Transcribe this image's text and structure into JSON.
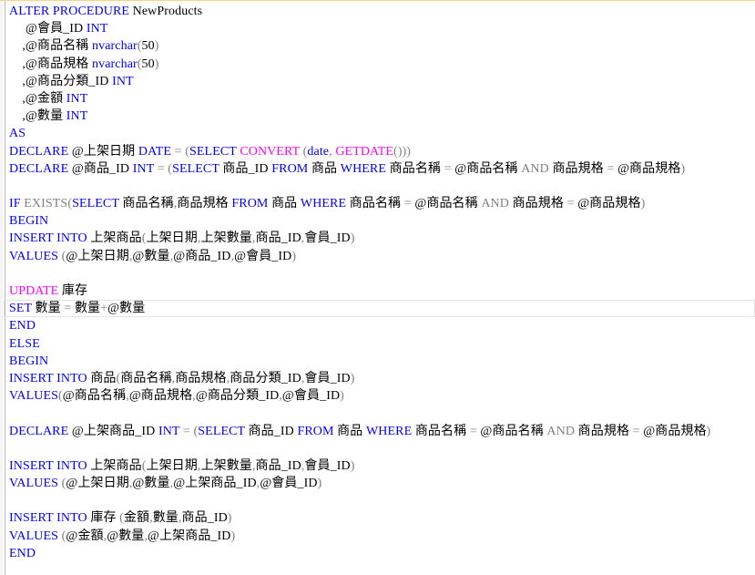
{
  "editor": {
    "lines": [
      [
        [
          "k",
          "ALTER PROCEDURE"
        ],
        [
          "t",
          " NewProducts"
        ]
      ],
      [
        [
          "t",
          "     @會員_ID "
        ],
        [
          "k",
          "INT"
        ]
      ],
      [
        [
          "t",
          "    ,@商品名稱 "
        ],
        [
          "k",
          "nvarchar"
        ],
        [
          "g",
          "("
        ],
        [
          "t",
          "50"
        ],
        [
          "g",
          ")"
        ]
      ],
      [
        [
          "t",
          "    ,@商品規格 "
        ],
        [
          "k",
          "nvarchar"
        ],
        [
          "g",
          "("
        ],
        [
          "t",
          "50"
        ],
        [
          "g",
          ")"
        ]
      ],
      [
        [
          "t",
          "    ,@商品分類_ID "
        ],
        [
          "k",
          "INT"
        ]
      ],
      [
        [
          "t",
          "    ,@金額 "
        ],
        [
          "k",
          "INT"
        ]
      ],
      [
        [
          "t",
          "    ,@數量 "
        ],
        [
          "k",
          "INT"
        ]
      ],
      [
        [
          "k",
          "AS"
        ]
      ],
      [
        [
          "k",
          "DECLARE"
        ],
        [
          "t",
          " @上架日期 "
        ],
        [
          "k",
          "DATE"
        ],
        [
          "g",
          " = ("
        ],
        [
          "k",
          "SELECT"
        ],
        [
          "t",
          " "
        ],
        [
          "p",
          "CONVERT"
        ],
        [
          "t",
          " "
        ],
        [
          "g",
          "("
        ],
        [
          "k",
          "date"
        ],
        [
          "g",
          ", "
        ],
        [
          "p",
          "GETDATE"
        ],
        [
          "g",
          "()))"
        ]
      ],
      [
        [
          "k",
          "DECLARE"
        ],
        [
          "t",
          " @商品_ID "
        ],
        [
          "k",
          "INT"
        ],
        [
          "g",
          " = ("
        ],
        [
          "k",
          "SELECT"
        ],
        [
          "t",
          " 商品_ID "
        ],
        [
          "k",
          "FROM"
        ],
        [
          "t",
          " 商品 "
        ],
        [
          "k",
          "WHERE"
        ],
        [
          "t",
          " 商品名稱 "
        ],
        [
          "g",
          "="
        ],
        [
          "t",
          " @商品名稱 "
        ],
        [
          "g",
          "AND"
        ],
        [
          "t",
          " 商品規格 "
        ],
        [
          "g",
          "="
        ],
        [
          "t",
          " @商品規格"
        ],
        [
          "g",
          ")"
        ]
      ],
      [],
      [
        [
          "k",
          "IF"
        ],
        [
          "t",
          " "
        ],
        [
          "g",
          "EXISTS("
        ],
        [
          "k",
          "SELECT"
        ],
        [
          "t",
          " 商品名稱"
        ],
        [
          "g",
          ","
        ],
        [
          "t",
          "商品規格 "
        ],
        [
          "k",
          "FROM"
        ],
        [
          "t",
          " 商品 "
        ],
        [
          "k",
          "WHERE"
        ],
        [
          "t",
          " 商品名稱 "
        ],
        [
          "g",
          "="
        ],
        [
          "t",
          " @商品名稱 "
        ],
        [
          "g",
          "AND"
        ],
        [
          "t",
          " 商品規格 "
        ],
        [
          "g",
          "="
        ],
        [
          "t",
          " @商品規格"
        ],
        [
          "g",
          ")"
        ]
      ],
      [
        [
          "k",
          "BEGIN"
        ]
      ],
      [
        [
          "k",
          "INSERT"
        ],
        [
          "t",
          " "
        ],
        [
          "k",
          "INTO"
        ],
        [
          "t",
          " 上架商品"
        ],
        [
          "g",
          "("
        ],
        [
          "t",
          "上架日期"
        ],
        [
          "g",
          ","
        ],
        [
          "t",
          "上架數量"
        ],
        [
          "g",
          ","
        ],
        [
          "t",
          "商品_ID"
        ],
        [
          "g",
          ","
        ],
        [
          "t",
          "會員_ID"
        ],
        [
          "g",
          ")"
        ]
      ],
      [
        [
          "k",
          "VALUES"
        ],
        [
          "t",
          " "
        ],
        [
          "g",
          "("
        ],
        [
          "t",
          "@上架日期"
        ],
        [
          "g",
          ","
        ],
        [
          "t",
          "@數量"
        ],
        [
          "g",
          ","
        ],
        [
          "t",
          "@商品_ID"
        ],
        [
          "g",
          ","
        ],
        [
          "t",
          "@會員_ID"
        ],
        [
          "g",
          ")"
        ]
      ],
      [],
      [
        [
          "p",
          "UPDATE"
        ],
        [
          "t",
          " 庫存"
        ]
      ],
      [
        [
          "k",
          "SET"
        ],
        [
          "t",
          " 數量 "
        ],
        [
          "g",
          "="
        ],
        [
          "t",
          " 數量"
        ],
        [
          "g",
          "+"
        ],
        [
          "t",
          "@數量"
        ]
      ],
      [
        [
          "k",
          "END"
        ]
      ],
      [
        [
          "k",
          "ELSE"
        ]
      ],
      [
        [
          "k",
          "BEGIN"
        ]
      ],
      [
        [
          "k",
          "INSERT"
        ],
        [
          "t",
          " "
        ],
        [
          "k",
          "INTO"
        ],
        [
          "t",
          " 商品"
        ],
        [
          "g",
          "("
        ],
        [
          "t",
          "商品名稱"
        ],
        [
          "g",
          ","
        ],
        [
          "t",
          "商品規格"
        ],
        [
          "g",
          ","
        ],
        [
          "t",
          "商品分類_ID"
        ],
        [
          "g",
          ","
        ],
        [
          "t",
          "會員_ID"
        ],
        [
          "g",
          ")"
        ]
      ],
      [
        [
          "k",
          "VALUES"
        ],
        [
          "g",
          "("
        ],
        [
          "t",
          "@商品名稱"
        ],
        [
          "g",
          ","
        ],
        [
          "t",
          "@商品規格"
        ],
        [
          "g",
          ","
        ],
        [
          "t",
          "@商品分類_ID"
        ],
        [
          "g",
          ","
        ],
        [
          "t",
          "@會員_ID"
        ],
        [
          "g",
          ")"
        ]
      ],
      [],
      [
        [
          "k",
          "DECLARE"
        ],
        [
          "t",
          " @上架商品_ID "
        ],
        [
          "k",
          "INT"
        ],
        [
          "g",
          " = ("
        ],
        [
          "k",
          "SELECT"
        ],
        [
          "t",
          " 商品_ID "
        ],
        [
          "k",
          "FROM"
        ],
        [
          "t",
          " 商品 "
        ],
        [
          "k",
          "WHERE"
        ],
        [
          "t",
          " 商品名稱 "
        ],
        [
          "g",
          "="
        ],
        [
          "t",
          " @商品名稱 "
        ],
        [
          "g",
          "AND"
        ],
        [
          "t",
          " 商品規格 "
        ],
        [
          "g",
          "="
        ],
        [
          "t",
          " @商品規格"
        ],
        [
          "g",
          ")"
        ]
      ],
      [],
      [
        [
          "k",
          "INSERT"
        ],
        [
          "t",
          " "
        ],
        [
          "k",
          "INTO"
        ],
        [
          "t",
          " 上架商品"
        ],
        [
          "g",
          "("
        ],
        [
          "t",
          "上架日期"
        ],
        [
          "g",
          ","
        ],
        [
          "t",
          "上架數量"
        ],
        [
          "g",
          ","
        ],
        [
          "t",
          "商品_ID"
        ],
        [
          "g",
          ","
        ],
        [
          "t",
          "會員_ID"
        ],
        [
          "g",
          ")"
        ]
      ],
      [
        [
          "k",
          "VALUES"
        ],
        [
          "t",
          " "
        ],
        [
          "g",
          "("
        ],
        [
          "t",
          "@上架日期"
        ],
        [
          "g",
          ","
        ],
        [
          "t",
          "@數量"
        ],
        [
          "g",
          ","
        ],
        [
          "t",
          "@上架商品_ID"
        ],
        [
          "g",
          ","
        ],
        [
          "t",
          "@會員_ID"
        ],
        [
          "g",
          ")"
        ]
      ],
      [],
      [
        [
          "k",
          "INSERT"
        ],
        [
          "t",
          " "
        ],
        [
          "k",
          "INTO"
        ],
        [
          "t",
          " 庫存 "
        ],
        [
          "g",
          "("
        ],
        [
          "t",
          "金額"
        ],
        [
          "g",
          ","
        ],
        [
          "t",
          "數量"
        ],
        [
          "g",
          ","
        ],
        [
          "t",
          "商品_ID"
        ],
        [
          "g",
          ")"
        ]
      ],
      [
        [
          "k",
          "VALUES"
        ],
        [
          "t",
          " "
        ],
        [
          "g",
          "("
        ],
        [
          "t",
          "@金額"
        ],
        [
          "g",
          ","
        ],
        [
          "t",
          "@數量"
        ],
        [
          "g",
          ","
        ],
        [
          "t",
          "@上架商品_ID"
        ],
        [
          "g",
          ")"
        ]
      ],
      [
        [
          "k",
          "END"
        ]
      ]
    ],
    "current_line": 17
  }
}
